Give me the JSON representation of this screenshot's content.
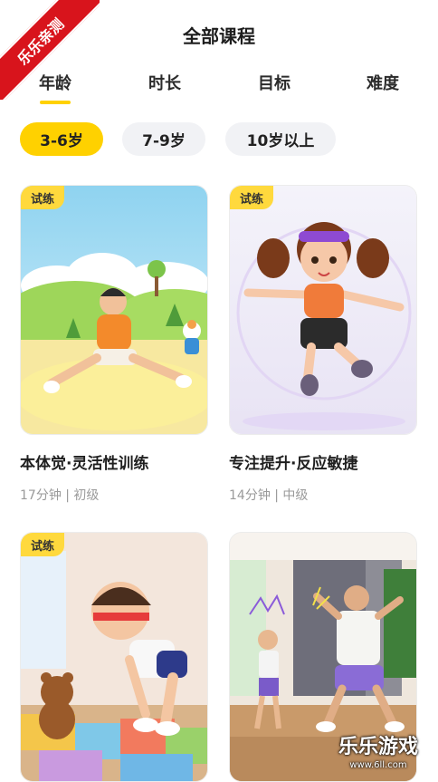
{
  "header": {
    "title": "全部课程"
  },
  "tabs": [
    {
      "label": "年龄",
      "active": true
    },
    {
      "label": "时长",
      "active": false
    },
    {
      "label": "目标",
      "active": false
    },
    {
      "label": "难度",
      "active": false
    }
  ],
  "age_filters": [
    {
      "label": "3-6岁",
      "active": true
    },
    {
      "label": "7-9岁",
      "active": false
    },
    {
      "label": "10岁以上",
      "active": false
    }
  ],
  "courses": [
    {
      "badge": "试练",
      "title": "本体觉·灵活性训练",
      "meta": "17分钟 | 初级"
    },
    {
      "badge": "试练",
      "title": "专注提升·反应敏捷",
      "meta": "14分钟 | 中级"
    },
    {
      "badge": "试练",
      "title": "",
      "meta": ""
    },
    {
      "badge": "",
      "title": "",
      "meta": ""
    }
  ],
  "overlays": {
    "corner_ribbon": "乐乐亲测",
    "watermark_main": "乐乐游戏",
    "watermark_url": "www.6ll.com"
  },
  "colors": {
    "accent": "#ffd100",
    "badge": "#ffd93d",
    "ribbon": "#d8141c"
  }
}
